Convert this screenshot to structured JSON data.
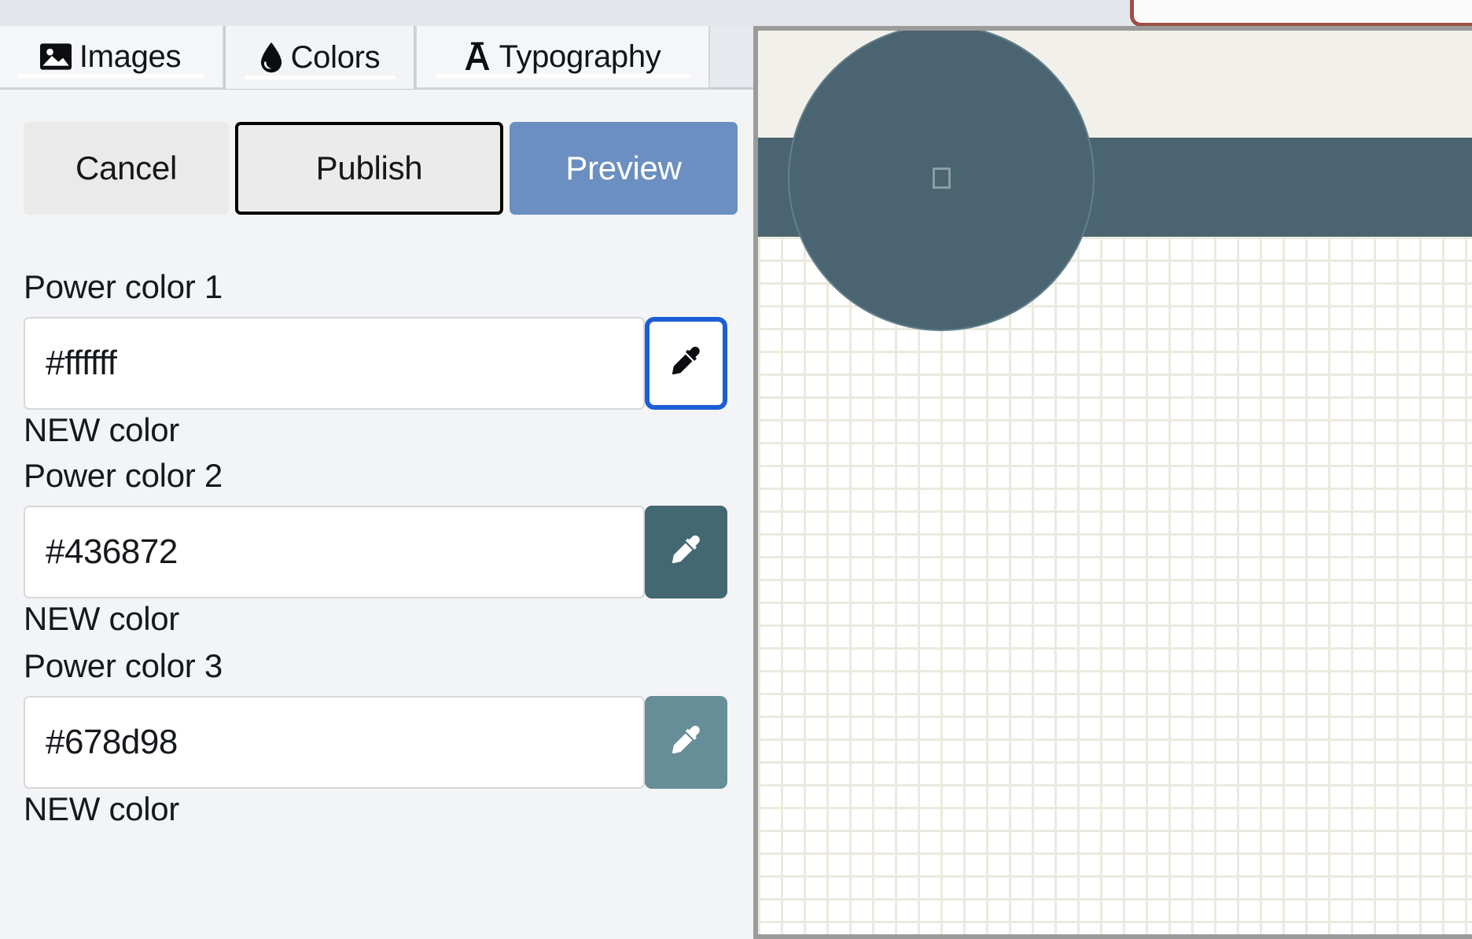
{
  "window": {
    "top_strip_color": "#e3e6ec",
    "browser_panel_border_color": "#9c4f43"
  },
  "sidebar": {
    "tabs": [
      {
        "id": "images",
        "label": "Images",
        "icon": "image-icon",
        "active": false
      },
      {
        "id": "colors",
        "label": "Colors",
        "icon": "droplet-icon",
        "active": true
      },
      {
        "id": "typography",
        "label": "Typography",
        "icon": "letter-a-icon",
        "active": false
      }
    ],
    "actions": {
      "cancel_label": "Cancel",
      "publish_label": "Publish",
      "preview_label": "Preview",
      "preview_bg_color": "#6b8fc0"
    },
    "color_fields": [
      {
        "label": "Power color 1",
        "value": "#ffffff",
        "placeholder": "#ffffff",
        "note": "NEW color",
        "swatch_color": "#ffffff",
        "swatch_icon": "eyedropper-icon",
        "swatch_icon_color": "#000000",
        "focused": true
      },
      {
        "label": "Power color 2",
        "value": "#436872",
        "placeholder": "#436872",
        "note": "NEW color",
        "swatch_color": "#436872",
        "swatch_icon": "eyedropper-icon",
        "swatch_icon_color": "#ffffff",
        "focused": false
      },
      {
        "label": "Power color 3",
        "value": "#678d98",
        "placeholder": "#678d98",
        "note": "NEW color",
        "swatch_color": "#678d98",
        "swatch_icon": "eyedropper-icon",
        "swatch_icon_color": "#ffffff",
        "focused": false
      }
    ]
  },
  "preview": {
    "band_cream_color": "#f2f0ea",
    "band_slate_color": "#4b6471",
    "pattern_line_color": "#eceade",
    "pattern_bg_color": "#ffffff",
    "circle_color": "#4b6471",
    "circle_glyph": "missing-glyph-box",
    "frame_color": "#9b9b9b"
  }
}
